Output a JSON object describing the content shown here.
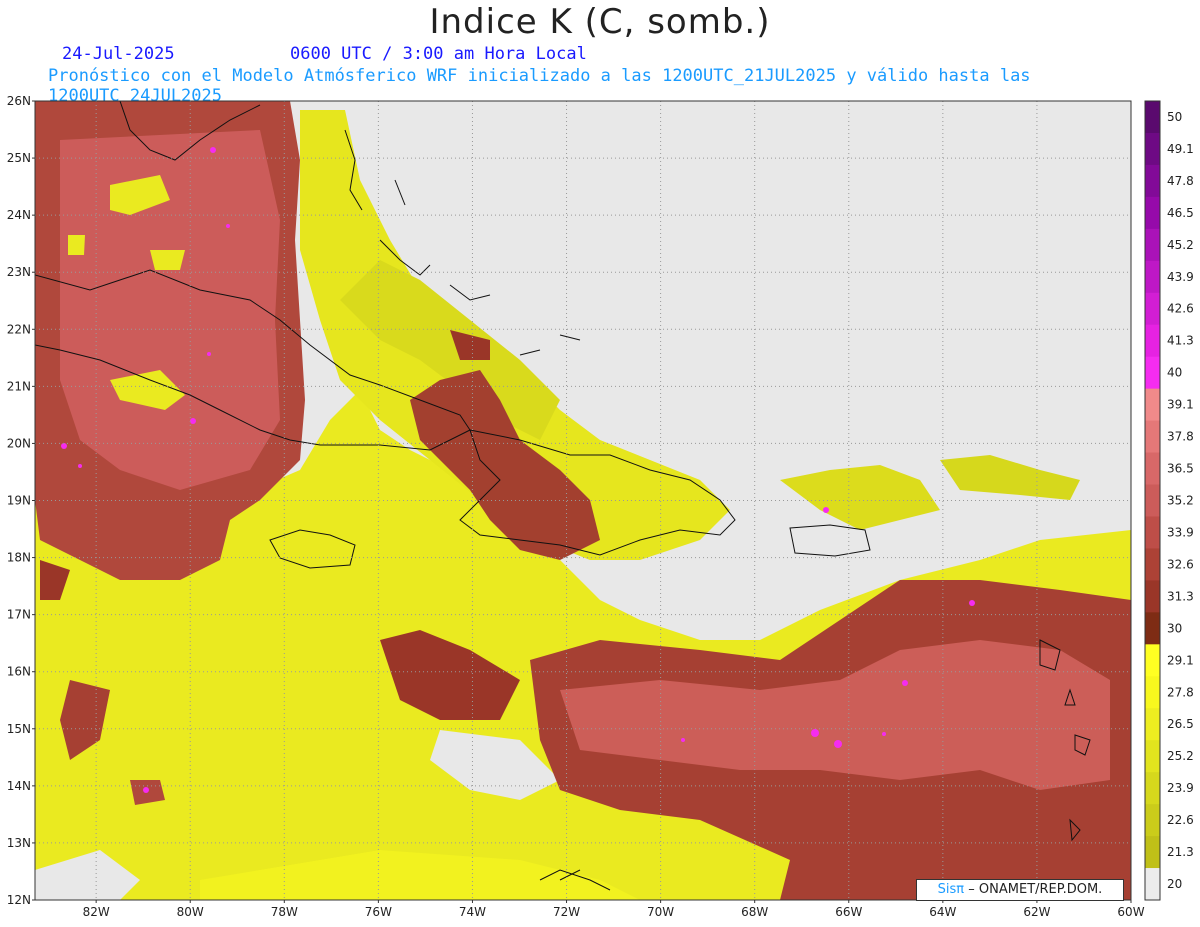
{
  "title": "Indice K (C, somb.)",
  "header": {
    "date": "24-Jul-2025",
    "time": "0600 UTC / 3:00 am Hora Local",
    "subtitle": "Pronóstico con el Modelo Atmósferico WRF inicializado a las 1200UTC_21JUL2025 y válido hasta las  1200UTC_24JUL2025"
  },
  "credit": {
    "brand": "Sisπ",
    "text": "– ONAMET/REP.DOM."
  },
  "map": {
    "lat_labels": [
      "26N",
      "25N",
      "24N",
      "23N",
      "22N",
      "21N",
      "20N",
      "19N",
      "18N",
      "17N",
      "16N",
      "15N",
      "14N",
      "13N",
      "12N"
    ],
    "lon_labels": [
      "82W",
      "80W",
      "78W",
      "76W",
      "74W",
      "72W",
      "70W",
      "68W",
      "66W",
      "64W",
      "62W",
      "60W"
    ],
    "lon_range": [
      -83.3,
      -60
    ],
    "lat_range": [
      12,
      26
    ]
  },
  "colorbar": {
    "levels": [
      "50",
      "49.1",
      "47.8",
      "46.5",
      "45.2",
      "43.9",
      "42.6",
      "41.3",
      "40",
      "39.1",
      "37.8",
      "36.5",
      "35.2",
      "33.9",
      "32.6",
      "31.3",
      "30",
      "29.1",
      "27.8",
      "26.5",
      "25.2",
      "23.9",
      "22.6",
      "21.3",
      "20"
    ],
    "colors": [
      "#5a0a6e",
      "#6e0a84",
      "#820a98",
      "#960aaa",
      "#aa12b8",
      "#be18c6",
      "#d21ed4",
      "#e622e2",
      "#f52cf0",
      "#f08a8a",
      "#e57878",
      "#d86868",
      "#cc5c5a",
      "#be4e48",
      "#ad4236",
      "#9a3628",
      "#7e2c14",
      "#ffff22",
      "#f8f81e",
      "#eeee20",
      "#e2e41e",
      "#d6d81c",
      "#cbcc1a",
      "#c0c018",
      "#ececec"
    ]
  }
}
